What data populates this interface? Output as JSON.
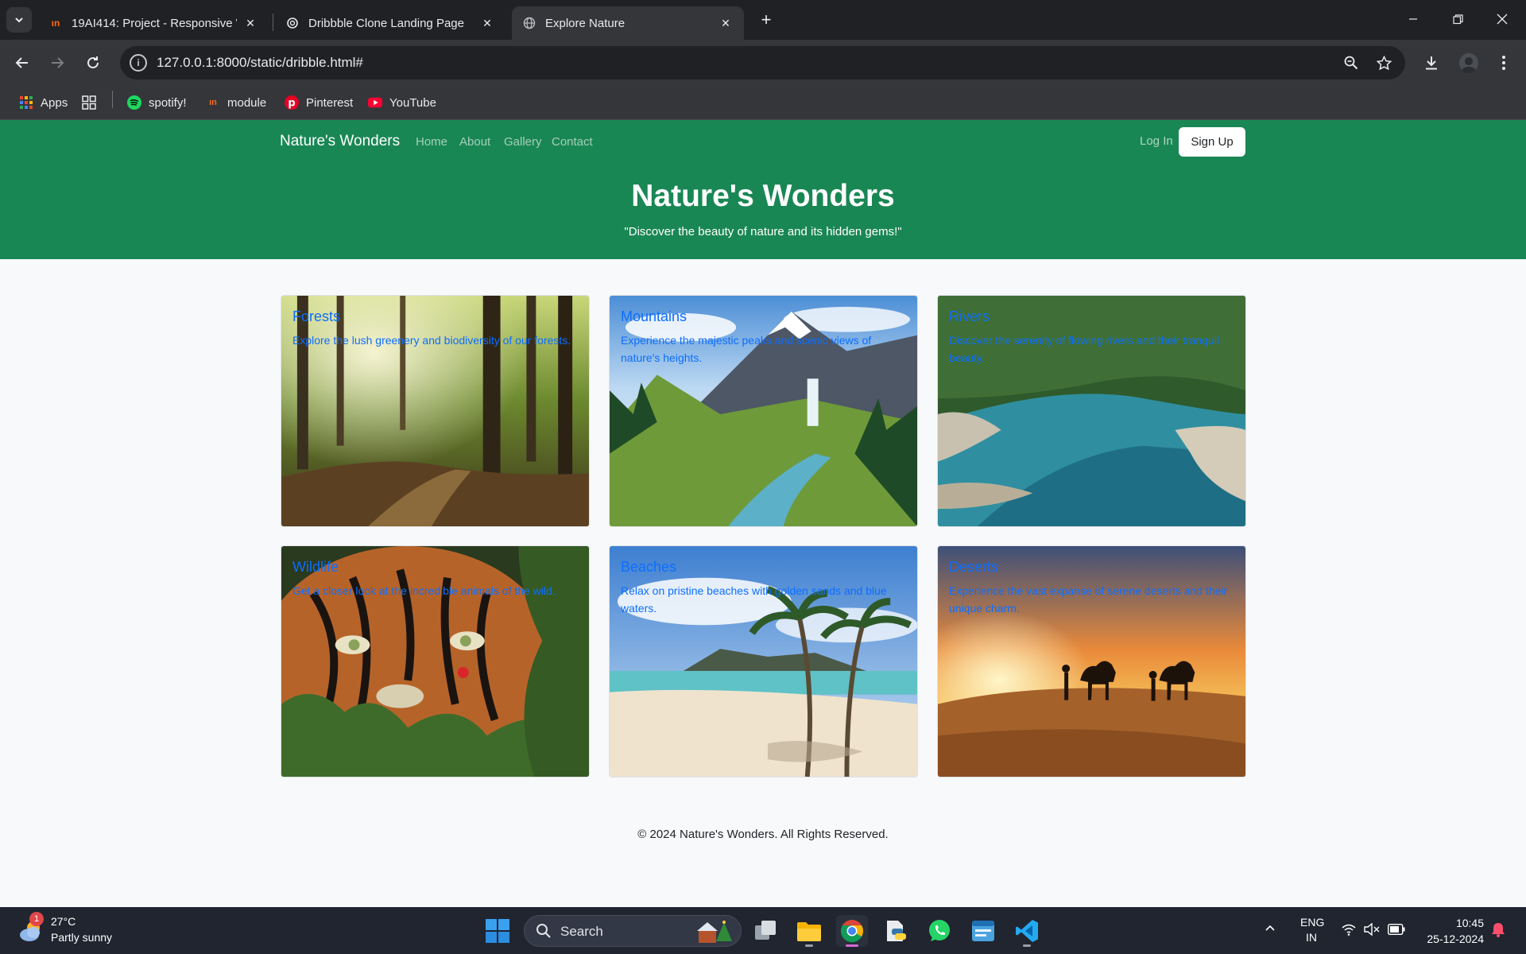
{
  "browser": {
    "tabs": [
      {
        "title": "19AI414: Project - Responsive W",
        "favicon": "mn"
      },
      {
        "title": "Dribbble Clone Landing Page",
        "favicon": "openai"
      },
      {
        "title": "Explore Nature",
        "favicon": "globe"
      }
    ],
    "url": "127.0.0.1:8000/static/dribble.html#",
    "bookmarks": [
      {
        "label": "Apps",
        "icon": "apps-grid-icon"
      },
      {
        "label": "spotify!",
        "icon": "spotify-icon"
      },
      {
        "label": "module",
        "icon": "mn"
      },
      {
        "label": "Pinterest",
        "icon": "pinterest-icon"
      },
      {
        "label": "YouTube",
        "icon": "youtube-icon"
      }
    ]
  },
  "site": {
    "brand": "Nature's Wonders",
    "nav": [
      "Home",
      "About",
      "Gallery",
      "Contact"
    ],
    "login": "Log In",
    "signup": "Sign Up",
    "hero_title": "Nature's Wonders",
    "hero_subtitle": "\"Discover the beauty of nature and its hidden gems!\"",
    "header_color": "#198754",
    "accent": "#0d6efd",
    "cards": [
      {
        "title": "Forests",
        "desc": "Explore the lush greenery and biodiversity of our forests."
      },
      {
        "title": "Mountains",
        "desc": "Experience the majestic peaks and scenic views of nature's heights."
      },
      {
        "title": "Rivers",
        "desc": "Discover the serenity of flowing rivers and their tranquil beauty."
      },
      {
        "title": "Wildlife",
        "desc": "Get a closer look at the incredible animals of the wild."
      },
      {
        "title": "Beaches",
        "desc": "Relax on pristine beaches with golden sands and blue waters."
      },
      {
        "title": "Deserts",
        "desc": "Experience the vast expanse of serene deserts and their unique charm."
      }
    ],
    "footer": "© 2024 Nature's Wonders. All Rights Reserved."
  },
  "taskbar": {
    "weather_temp": "27°C",
    "weather_cond": "Partly sunny",
    "weather_badge": "1",
    "search": "Search",
    "lang1": "ENG",
    "lang2": "IN",
    "time": "10:45",
    "date": "25-12-2024"
  }
}
